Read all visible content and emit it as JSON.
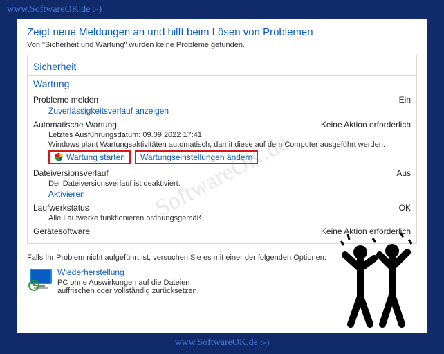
{
  "watermark": {
    "top": "www.SoftwareOK.de :-)",
    "bottom": "www.SoftwareOK.de :-)",
    "diagonal": "SoftwareOK.de"
  },
  "page": {
    "title": "Zeigt neue Meldungen an und hilft beim Lösen von Problemen",
    "subtitle": "Von \"Sicherheit und Wartung\" wurden keine Probleme gefunden."
  },
  "sections": {
    "security_header": "Sicherheit",
    "maintenance_header": "Wartung"
  },
  "problems": {
    "label": "Probleme melden",
    "status": "Ein",
    "link": "Zuverlässigkeitsverlauf anzeigen"
  },
  "auto_maint": {
    "label": "Automatische Wartung",
    "status": "Keine Aktion erforderlich",
    "last_run": "Letztes Ausführungsdatum: 09.09.2022 17:41",
    "desc": "Windows plant Wartungsaktivitäten automatisch, damit diese auf dem Computer ausgeführt werden.",
    "start_link": "Wartung starten",
    "settings_link": "Wartungseinstellungen ändern"
  },
  "file_history": {
    "label": "Dateiversionsverlauf",
    "status": "Aus",
    "desc": "Der Dateiversionsverlauf ist deaktiviert.",
    "link": "Aktivieren"
  },
  "drive_status": {
    "label": "Laufwerkstatus",
    "status": "OK",
    "desc": "Alle Laufwerke funktionieren ordnungsgemäß."
  },
  "device_status": {
    "label": "Gerätesoftware",
    "status": "Keine Aktion erforderlich"
  },
  "footer": {
    "text": "Falls Ihr Problem nicht aufgeführt ist, versuchen Sie es mit einer der folgenden Optionen:",
    "recovery_link": "Wiederherstellung",
    "recovery_desc": "PC ohne Auswirkungen auf die Dateien auffrischen oder vollständig zurücksetzen."
  }
}
